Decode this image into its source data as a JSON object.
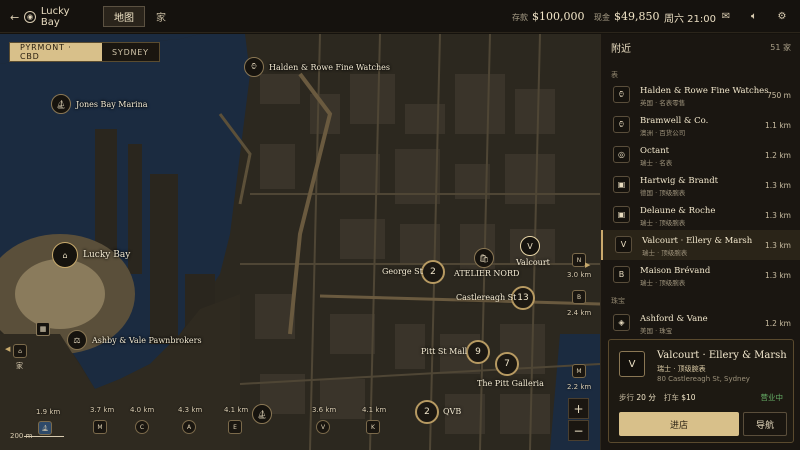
{
  "topbar": {
    "location": "Lucky Bay",
    "tab_map": "地图",
    "tab_home": "家",
    "savings_label": "存款",
    "savings_value": "$100,000",
    "cash_label": "现金",
    "cash_value": "$49,850",
    "time": "周六 21:00"
  },
  "map": {
    "region_active": "PYRMONT · CBD",
    "region_other": "SYDNEY",
    "pois": {
      "halden": "Halden & Rowe Fine Watches",
      "marina": "Jones Bay Marina",
      "lucky_bay": "Lucky Bay",
      "pawn": "Ashby & Vale Pawnbrokers",
      "george": "George St",
      "atelier": "ATELIER NORD",
      "valcourt": "Valcourt",
      "castlereagh": "Castlereagh St",
      "pitt_mall": "Pitt St Mall",
      "pitt_galleria": "The Pitt Galleria",
      "qvb": "QVB",
      "home": "家"
    },
    "clusters": {
      "george": "2",
      "castlereagh": "13",
      "pitt_mall": "9",
      "pitt_galleria": "7",
      "qvb": "2"
    },
    "bottom_distances": [
      "1.9 km",
      "3.7 km",
      "4.0 km",
      "4.3 km",
      "4.1 km",
      "3.6 km",
      "4.1 km"
    ],
    "right_distances": [
      "3.0 km",
      "2.4 km",
      "2.2 km"
    ],
    "scale_label": "200 m",
    "zoom_in": "+",
    "zoom_out": "−"
  },
  "panel": {
    "title": "附近",
    "count": "51 家",
    "cat_watch": "表",
    "cat_jewel": "珠宝",
    "rows": [
      {
        "name": "Halden & Rowe Fine Watches",
        "sub": "英国 · 名表零售",
        "dist": "750 m"
      },
      {
        "name": "Bramwell & Co.",
        "sub": "澳洲 · 百货公司",
        "dist": "1.1 km"
      },
      {
        "name": "Octant",
        "sub": "瑞士 · 名表",
        "dist": "1.2 km"
      },
      {
        "name": "Hartwig & Brandt",
        "sub": "德国 · 顶级腕表",
        "dist": "1.3 km"
      },
      {
        "name": "Delaune & Roche",
        "sub": "瑞士 · 顶级腕表",
        "dist": "1.3 km"
      },
      {
        "name": "Valcourt · Ellery & Marsh",
        "sub": "瑞士 · 顶级腕表",
        "dist": "1.3 km"
      },
      {
        "name": "Maison Brévand",
        "sub": "瑞士 · 顶级腕表",
        "dist": "1.3 km"
      },
      {
        "name": "Ashford & Vane",
        "sub": "美国 · 珠宝",
        "dist": "1.2 km"
      }
    ],
    "card": {
      "name": "Valcourt · Ellery & Marsh",
      "sub": "瑞士 · 顶级腕表",
      "addr": "80 Castlereagh St, Sydney",
      "walk_label": "步行",
      "walk_value": "20 分",
      "taxi_label": "打车",
      "taxi_value": "$10",
      "status": "营业中",
      "enter": "进店",
      "navigate": "导航"
    }
  },
  "colors": {
    "accent": "#d8c08a",
    "open": "#66b067",
    "water": "#1a2a3f"
  }
}
